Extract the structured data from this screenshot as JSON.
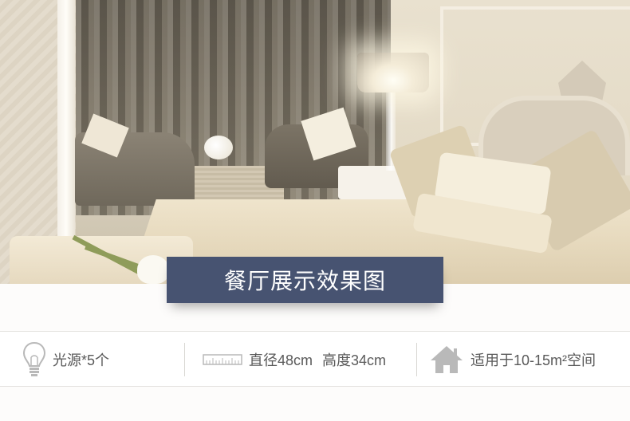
{
  "banner": {
    "title": "餐厅展示效果图"
  },
  "features": {
    "light_sources": {
      "icon": "lightbulb-icon",
      "label": "光源*5个"
    },
    "dimensions": {
      "icon": "ruler-icon",
      "diameter": "直径48cm",
      "height": "高度34cm"
    },
    "room_area": {
      "icon": "house-icon",
      "label": "适用于10-15m²空间"
    }
  },
  "colors": {
    "banner_bg": "#475371",
    "feature_text": "#5a5a5a",
    "icon_gray": "#b9b9b9"
  }
}
